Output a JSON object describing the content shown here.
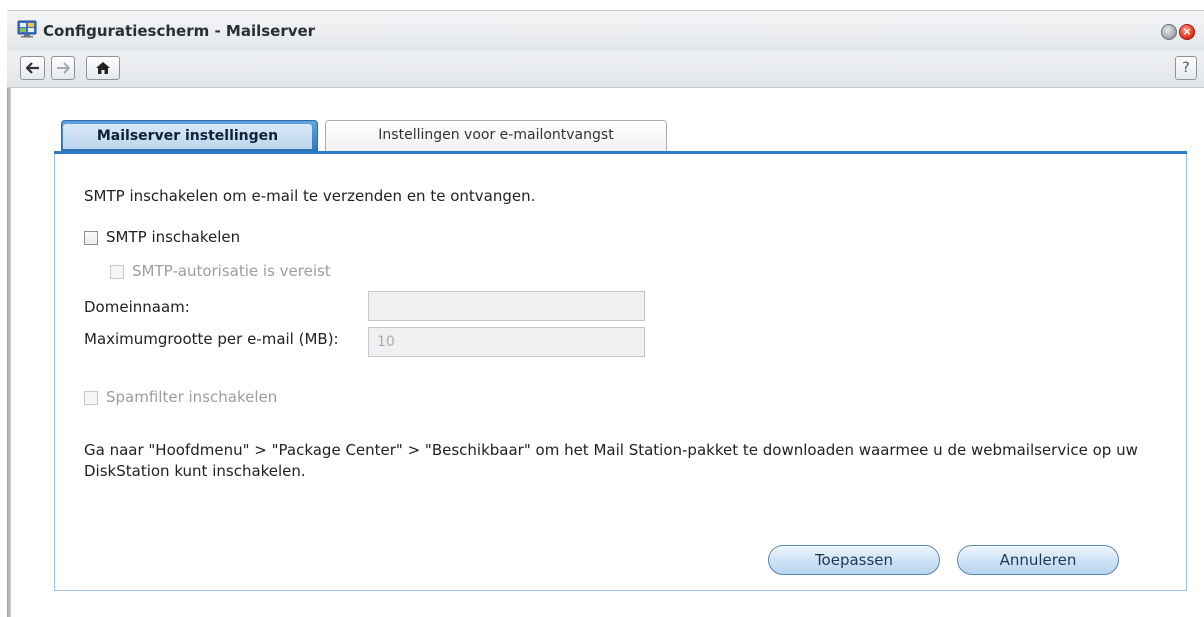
{
  "window": {
    "title": "Configuratiescherm - Mailserver"
  },
  "toolbar": {
    "back_icon": "arrow-left-icon",
    "forward_icon": "arrow-right-icon",
    "home_icon": "home-icon",
    "help_label": "?"
  },
  "tabs": [
    {
      "label": "Mailserver instellingen",
      "active": true
    },
    {
      "label": "Instellingen voor e-mailontvangst",
      "active": false
    }
  ],
  "form": {
    "intro": "SMTP inschakelen om e-mail te verzenden en te ontvangen.",
    "smtp_enable_label": "SMTP inschakelen",
    "smtp_enable_checked": false,
    "smtp_auth_label": "SMTP-autorisatie is vereist",
    "smtp_auth_checked": false,
    "domain_label": "Domeinnaam:",
    "domain_value": "",
    "max_size_label": "Maximumgrootte per e-mail (MB):",
    "max_size_value": "10",
    "spam_label": "Spamfilter inschakelen",
    "spam_checked": false,
    "note": "Ga naar \"Hoofdmenu\" > \"Package Center\" > \"Beschikbaar\" om het Mail Station-pakket te downloaden waarmee u de webmailservice op uw DiskStation kunt inschakelen."
  },
  "buttons": {
    "apply": "Toepassen",
    "cancel": "Annuleren"
  },
  "colors": {
    "accent": "#2e7dc4",
    "button_border": "#5a86b0",
    "disabled_text": "#9a9ea3"
  }
}
